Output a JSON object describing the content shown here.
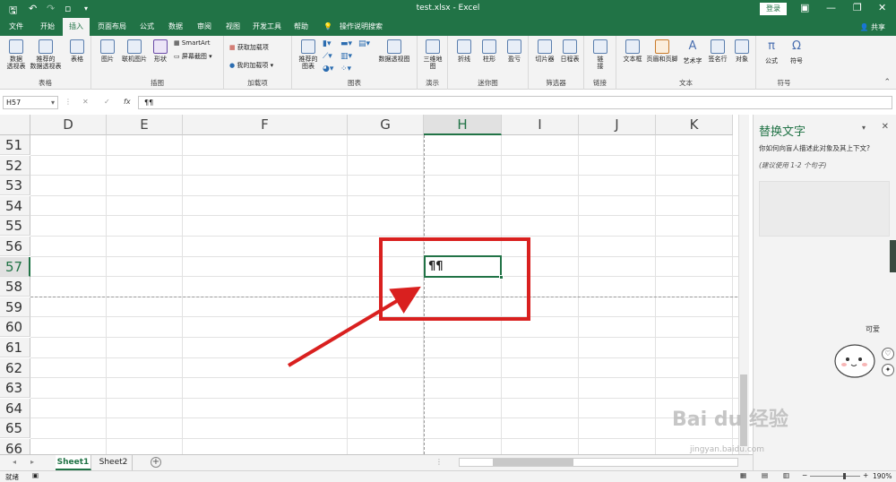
{
  "title": "test.xlsx  -  Excel",
  "login_label": "登录",
  "share_label": "共享",
  "tabs": [
    "文件",
    "开始",
    "插入",
    "页面布局",
    "公式",
    "数据",
    "审阅",
    "视图",
    "开发工具",
    "帮助",
    "操作说明搜索"
  ],
  "active_tab": "插入",
  "ribbon": {
    "groups": {
      "tables": "表格",
      "illustrations": "插图",
      "addins": "加载项",
      "charts": "图表",
      "tours": "演示",
      "sparklines": "迷你图",
      "filters": "筛选器",
      "links": "链接",
      "text": "文本",
      "symbols": "符号"
    },
    "buttons": {
      "pivot": "数据\n透视表",
      "rec_pivot": "推荐的\n数据透视表",
      "table": "表格",
      "picture": "图片",
      "online_picture": "联机图片",
      "shapes": "形状",
      "smartart": "SmartArt",
      "screenshot": "屏幕截图",
      "get_addins": "获取加载项",
      "my_addins": "我的加载项",
      "rec_charts": "推荐的\n图表",
      "pivot_chart": "数据透视图",
      "map3d": "三维地\n图",
      "line": "折线",
      "column": "柱形",
      "winloss": "盈亏",
      "slicer": "切片器",
      "timeline": "日程表",
      "link": "链\n接",
      "textbox": "文本框",
      "header_footer": "页眉和页脚",
      "wordart": "艺术字",
      "signature": "签名行",
      "object": "对象",
      "equation": "公式",
      "symbol": "符号"
    }
  },
  "formula_bar": {
    "name_box": "H57",
    "cancel": "✕",
    "enter": "✓",
    "fx": "fx",
    "value": "¶¶"
  },
  "columns": [
    "D",
    "E",
    "F",
    "G",
    "H",
    "I",
    "J",
    "K"
  ],
  "selected_column": "H",
  "rows": [
    "51",
    "52",
    "53",
    "54",
    "55",
    "56",
    "57",
    "58",
    "59",
    "60",
    "61",
    "62",
    "63",
    "64",
    "65",
    "66"
  ],
  "selected_row": "57",
  "active_cell_value": "¶¶",
  "sheets": [
    "Sheet1",
    "Sheet2"
  ],
  "active_sheet": "Sheet1",
  "status": {
    "ready": "就绪",
    "zoom": "190%"
  },
  "pane": {
    "title": "替换文字",
    "question": "你如何向盲人描述此对象及其上下文?",
    "hint": "(建议使用 1-2 个句子)"
  },
  "decoration_text": "可爱",
  "watermark": "Bai du 经验",
  "watermark_url": "jingyan.baidu.com",
  "colors": {
    "excel_green": "#217346",
    "red_highlight": "#d9201f"
  }
}
